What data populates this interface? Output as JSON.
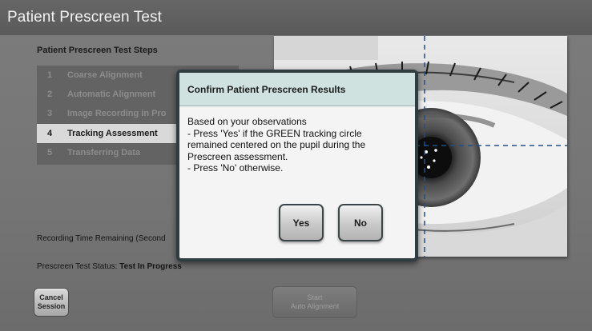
{
  "window": {
    "title": "Patient Prescreen Test"
  },
  "steps": {
    "title": "Patient Prescreen Test Steps",
    "items": [
      {
        "num": "1",
        "label": "Coarse Alignment"
      },
      {
        "num": "2",
        "label": "Automatic Alignment"
      },
      {
        "num": "3",
        "label": "Image Recording in Pro"
      },
      {
        "num": "4",
        "label": "Tracking Assessment",
        "active": true
      },
      {
        "num": "5",
        "label": "Transferring Data"
      }
    ]
  },
  "status": {
    "recording_label": "Recording Time Remaining (Second",
    "test_status_label": "Prescreen Test Status:",
    "test_status_value": "Test In Progress"
  },
  "buttons": {
    "cancel_line1": "Cancel",
    "cancel_line2": "Session",
    "start_line1": "Start",
    "start_line2": "Auto Alignment"
  },
  "dialog": {
    "title": "Confirm Patient Prescreen Results",
    "lines": [
      "Based on your observations",
      "- Press 'Yes' if the GREEN tracking circle",
      "remained centered on the pupil during the",
      "Prescreen assessment.",
      "- Press 'No' otherwise."
    ],
    "yes_label": "Yes",
    "no_label": "No"
  },
  "colors": {
    "title_bar": "#5f5f5f",
    "background": "#777777",
    "dialog_header": "#cfe2e0",
    "dialog_border": "#2f3c40",
    "crosshair": "#1f4f8f"
  }
}
